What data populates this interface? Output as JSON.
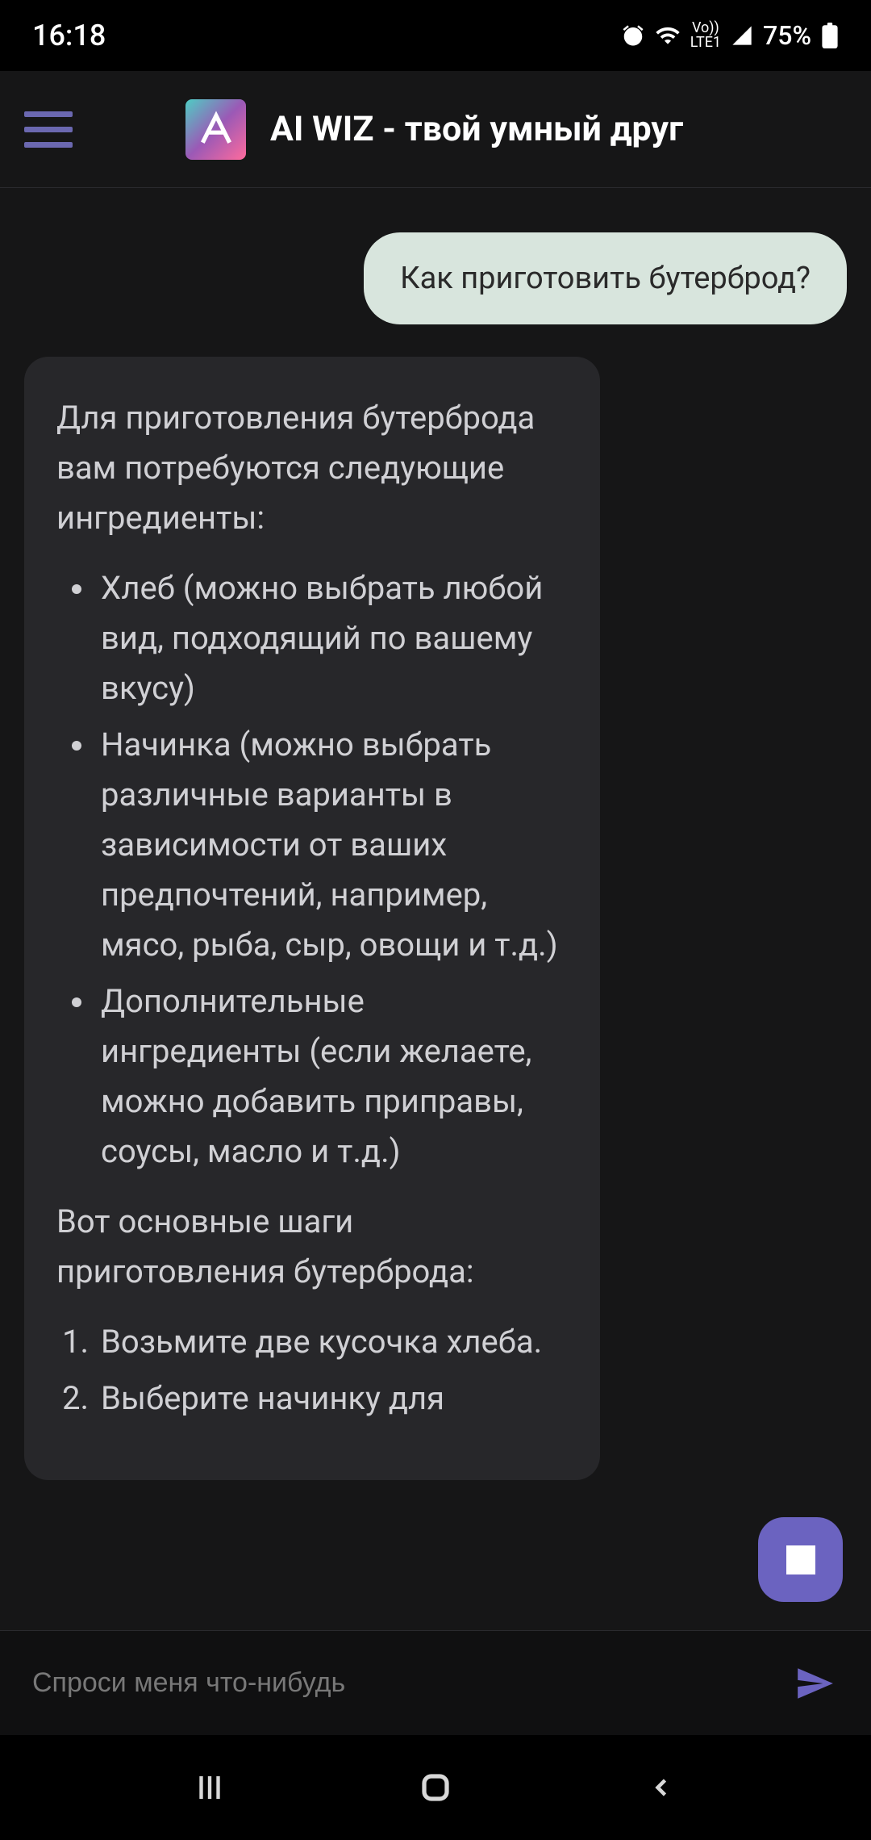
{
  "status_bar": {
    "time": "16:18",
    "network_label": "LTE1",
    "vo_label": "Vo))",
    "battery_percent": "75%"
  },
  "header": {
    "app_title": "AI WIZ - твой умный друг"
  },
  "chat": {
    "user_message": "Как приготовить бутерброд?",
    "assistant": {
      "intro": "Для приготовления бутерброда вам потребуются следующие ингредиенты:",
      "ingredients": [
        "Хлеб (можно выбрать любой вид, подходящий по вашему вкусу)",
        "Начинка (можно выбрать различные варианты в зависимости от ваших предпочтений, например, мясо, рыба, сыр, овощи и т.д.)",
        "Дополнительные ингредиенты (если желаете, можно добавить приправы, соусы, масло и т.д.)"
      ],
      "steps_intro": "Вот основные шаги приготовления бутерброда:",
      "steps": [
        "Возьмите две кусочка хлеба.",
        "Выберите начинку для"
      ]
    }
  },
  "input": {
    "placeholder": "Спроси меня что-нибудь"
  },
  "colors": {
    "accent": "#6b63c0",
    "user_bubble": "#d8e5dd",
    "assistant_bubble": "#27272a"
  }
}
